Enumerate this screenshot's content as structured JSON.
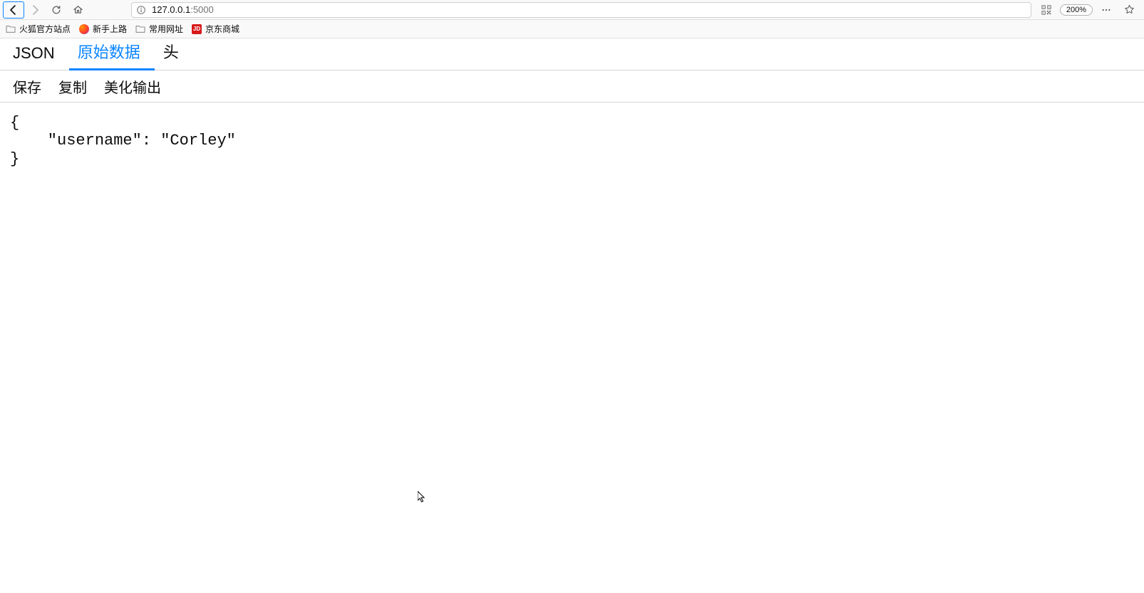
{
  "toolbar": {
    "url_host": "127.0.0.1",
    "url_port": ":5000",
    "zoom": "200%"
  },
  "bookmarks": {
    "items": [
      {
        "label": "火狐官方站点",
        "icon": "folder"
      },
      {
        "label": "新手上路",
        "icon": "firefox"
      },
      {
        "label": "常用网址",
        "icon": "folder"
      },
      {
        "label": "京东商城",
        "icon": "jd",
        "jd_text": "JD"
      }
    ]
  },
  "viewer": {
    "tabs": [
      {
        "label": "JSON",
        "active": false
      },
      {
        "label": "原始数据",
        "active": true
      },
      {
        "label": "头",
        "active": false
      }
    ],
    "actions": [
      {
        "label": "保存"
      },
      {
        "label": "复制"
      },
      {
        "label": "美化输出"
      }
    ]
  },
  "content": {
    "raw_text": "{\n    \"username\": \"Corley\"\n}"
  }
}
